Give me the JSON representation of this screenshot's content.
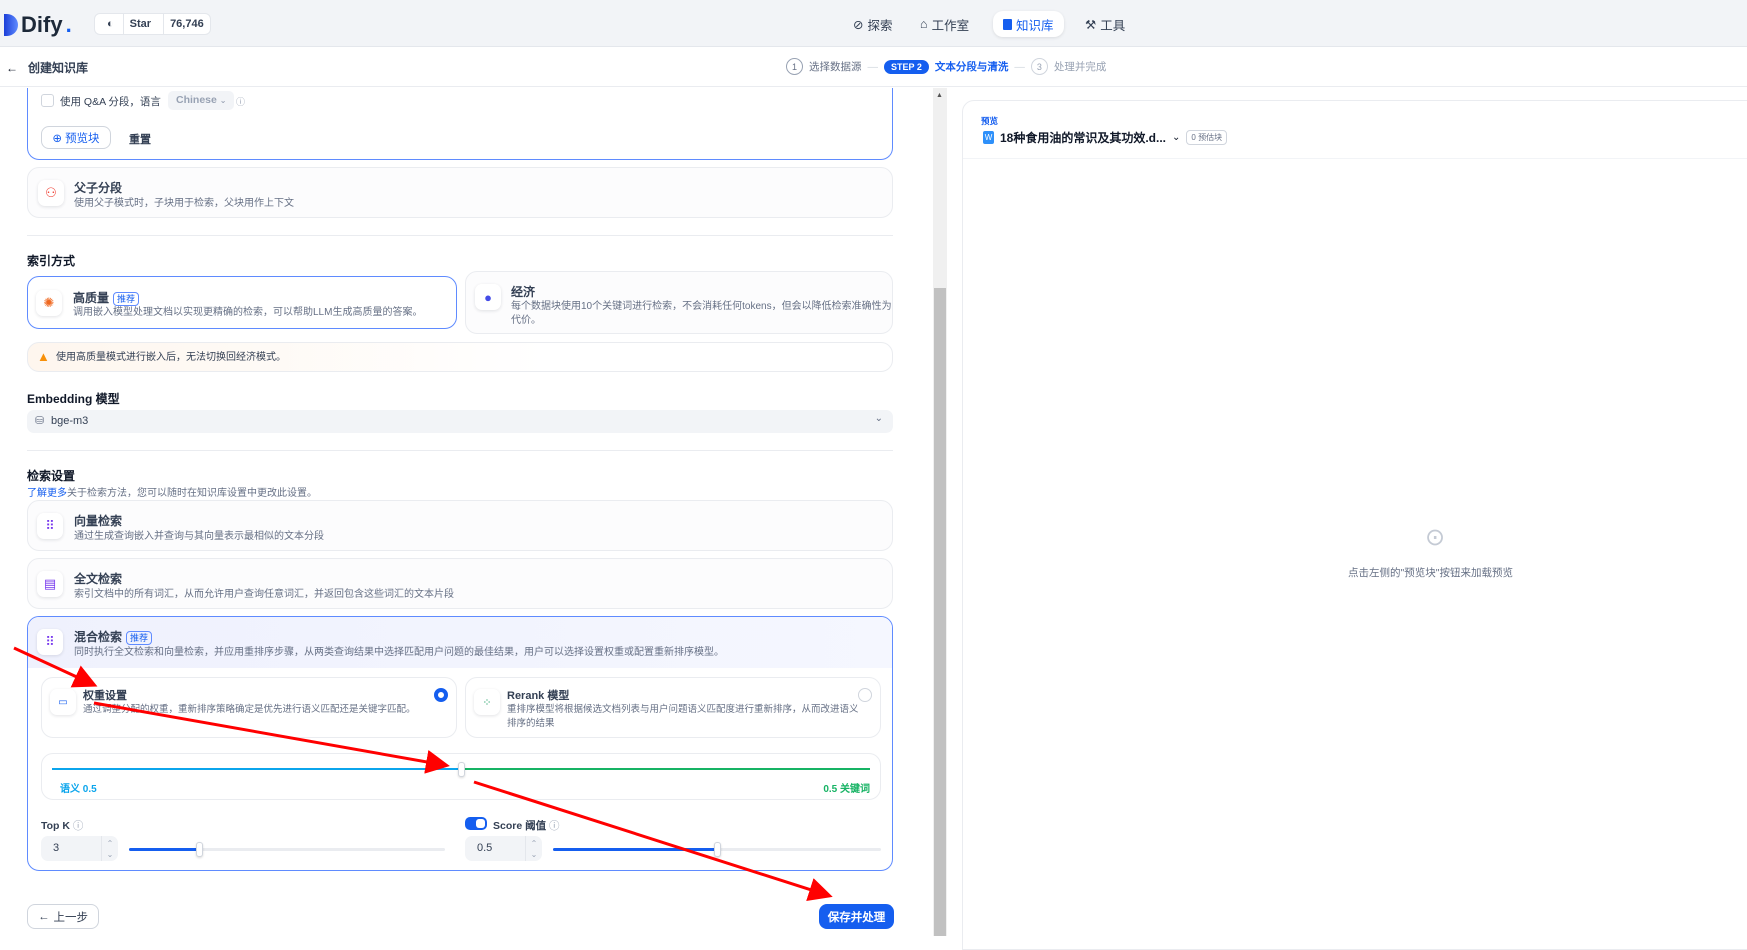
{
  "header": {
    "brand": "Dify",
    "github_star_label": "Star",
    "github_star_count": "76,746",
    "nav": [
      {
        "label": "探索",
        "icon": "compass-icon"
      },
      {
        "label": "工作室",
        "icon": "robot-icon"
      },
      {
        "label": "知识库",
        "icon": "book-icon",
        "active": true
      },
      {
        "label": "工具",
        "icon": "hammer-icon"
      }
    ]
  },
  "subheader": {
    "back_title": "创建知识库",
    "steps": [
      {
        "num": "1",
        "label": "选择数据源",
        "state": "done"
      },
      {
        "num": "STEP 2",
        "label": "文本分段与清洗",
        "state": "active"
      },
      {
        "num": "3",
        "label": "处理并完成",
        "state": "pending"
      }
    ]
  },
  "chunk": {
    "qa_label": "使用 Q&A 分段，语言",
    "qa_checked": false,
    "language": "Chinese",
    "preview_button": "预览块",
    "reset_button": "重置",
    "parent_child_title": "父子分段",
    "parent_child_desc": "使用父子模式时，子块用于检索，父块用作上下文"
  },
  "index": {
    "section_title": "索引方式",
    "high_quality_title": "高质量",
    "recommended_tag": "推荐",
    "high_quality_desc": "调用嵌入模型处理文档以实现更精确的检索，可以帮助LLM生成高质量的答案。",
    "economy_title": "经济",
    "economy_desc_1": "每个数据块使用10个关键词进行检索，不会消耗任何tokens，但会以降低检索准确性为",
    "economy_desc_2": "代价。",
    "warning": "使用高质量模式进行嵌入后，无法切换回经济模式。"
  },
  "embedding": {
    "label": "Embedding 模型",
    "model": "bge-m3"
  },
  "retrieval": {
    "section_title": "检索设置",
    "learn_more": "了解更多",
    "intro": "关于检索方法，您可以随时在知识库设置中更改此设置。",
    "vector_title": "向量检索",
    "vector_desc": "通过生成查询嵌入并查询与其向量表示最相似的文本分段",
    "fulltext_title": "全文检索",
    "fulltext_desc": "索引文档中的所有词汇，从而允许用户查询任意词汇，并返回包含这些词汇的文本片段",
    "hybrid_title": "混合检索",
    "hybrid_tag": "推荐",
    "hybrid_desc": "同时执行全文检索和向量检索，并应用重排序步骤，从两类查询结果中选择匹配用户问题的最佳结果，用户可以选择设置权重或配置重新排序模型。",
    "weight_title": "权重设置",
    "weight_desc": "通过调整分配的权重，重新排序策略确定是优先进行语义匹配还是关键字匹配。",
    "weight_selected": true,
    "rerank_title": "Rerank 模型",
    "rerank_desc_1": "重排序模型将根据候选文档列表与用户问题语义匹配度进行重新排序，从而改进语义",
    "rerank_desc_2": "排序的结果",
    "rerank_selected": false,
    "semantic_label": "语义 0.5",
    "keyword_label": "0.5 关键词",
    "semantic_weight": 0.5,
    "top_k_label": "Top K",
    "top_k": "3",
    "top_k_slider_fraction": 0.22,
    "score_label": "Score 阈值",
    "score_enabled": true,
    "score": "0.5",
    "score_slider_fraction": 0.5
  },
  "footer": {
    "prev_button": "上一步",
    "save_button": "保存并处理"
  },
  "preview": {
    "label": "预览",
    "file_name": "18种食用油的常识及其功效.d...",
    "chunk_count": "0 预估块",
    "empty_hint": "点击左侧的\"预览块\"按钮来加载预览"
  },
  "colors": {
    "accent": "#155eef",
    "semantic": "#0ba5ec",
    "keyword": "#16b364",
    "warning": "#f79009"
  }
}
